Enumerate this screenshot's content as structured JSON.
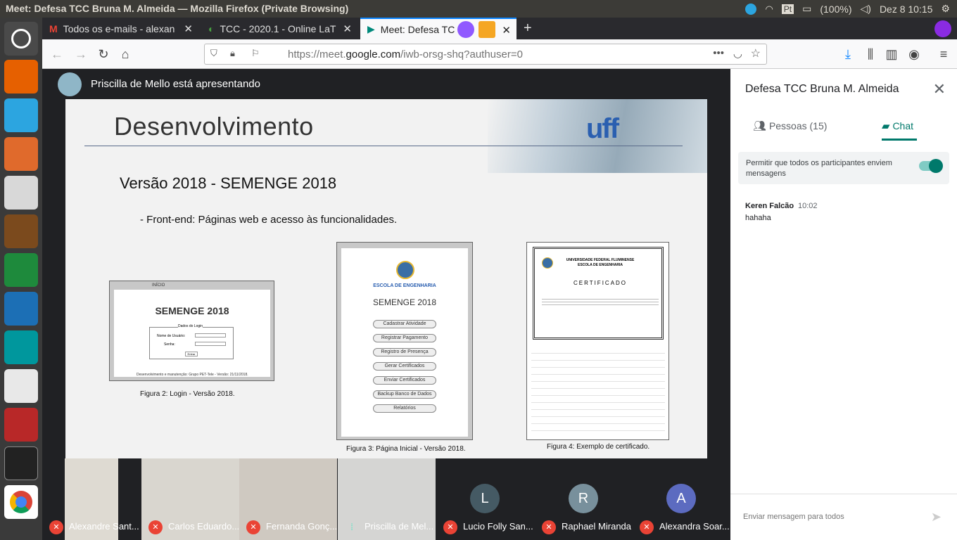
{
  "window_title": "Meet: Defesa TCC Bruna M. Almeida — Mozilla Firefox (Private Browsing)",
  "tray": {
    "battery": "(100%)",
    "clock": "Dez  8 10:15",
    "kbd": "Pt"
  },
  "tabs": [
    {
      "label": "Todos os e-mails - alexan"
    },
    {
      "label": "TCC - 2020.1 - Online LaT"
    },
    {
      "label": "Meet: Defesa TC"
    }
  ],
  "new_tab": "+",
  "url": {
    "prefix": "https://meet.",
    "domain": "google.com",
    "path": "/iwb-orsg-shq?authuser=0"
  },
  "stage": {
    "presenter": "Priscilla de Mello está apresentando"
  },
  "slide": {
    "title": "Desenvolvimento",
    "subtitle": "Versão 2018 - SEMENGE 2018",
    "bullet": "- Front-end: Páginas web e acesso às funcionalidades.",
    "logo": "uff",
    "fig2": {
      "header": "INÍCIO",
      "heading": "SEMENGE 2018",
      "legend": "Dados do Login",
      "user_label": "Nome de Usuário:",
      "pass_label": "Senha:",
      "button": "Entrar",
      "footer": "Desenvolvimento e manutenção: Grupo PET-Tele - Versão: 21/11/2018.",
      "caption": "Figura 2: Login - Versão 2018."
    },
    "fig3": {
      "school": "ESCOLA DE ENGENHARIA",
      "heading": "SEMENGE 2018",
      "buttons": [
        "Cadastrar Atividade",
        "Registrar Pagamento",
        "Registro de Presença",
        "Gerar Certificados",
        "Enviar Certificados",
        "Backup Banco de Dados",
        "Relatórios"
      ],
      "caption": "Figura 3: Página Inicial - Versão 2018."
    },
    "fig4": {
      "uni": "UNIVERSIDADE FEDERAL FLUMINENSE",
      "school": "ESCOLA DE ENGENHARIA",
      "cert": "CERTIFICADO",
      "caption": "Figura 4: Exemplo de certificado."
    }
  },
  "participants": [
    {
      "name": "Alexandre Sant...",
      "muted": true
    },
    {
      "name": "Carlos Eduardo...",
      "muted": true
    },
    {
      "name": "Fernanda Gonç...",
      "muted": true
    },
    {
      "name": "Priscilla de Mel...",
      "muted": false
    },
    {
      "name": "Lucio Folly San...",
      "muted": true,
      "letter": "L",
      "color": "#455a64"
    },
    {
      "name": "Raphael Miranda",
      "muted": true,
      "letter": "R",
      "color": "#78909c"
    },
    {
      "name": "Alexandra Soar...",
      "muted": true,
      "letter": "A",
      "color": "#5c6bc0"
    }
  ],
  "panel": {
    "title": "Defesa TCC Bruna M. Almeida",
    "people_tab": "Pessoas (15)",
    "chat_tab": "Chat",
    "permission": "Permitir que todos os participantes enviem mensagens",
    "message": {
      "sender": "Keren Falcão",
      "time": "10:02",
      "text": "hahaha"
    },
    "input_placeholder": "Enviar mensagem para todos"
  },
  "colors": {
    "accent": "#00796b",
    "muted_red": "#ea4335",
    "firefox_blue": "#0a84ff"
  }
}
